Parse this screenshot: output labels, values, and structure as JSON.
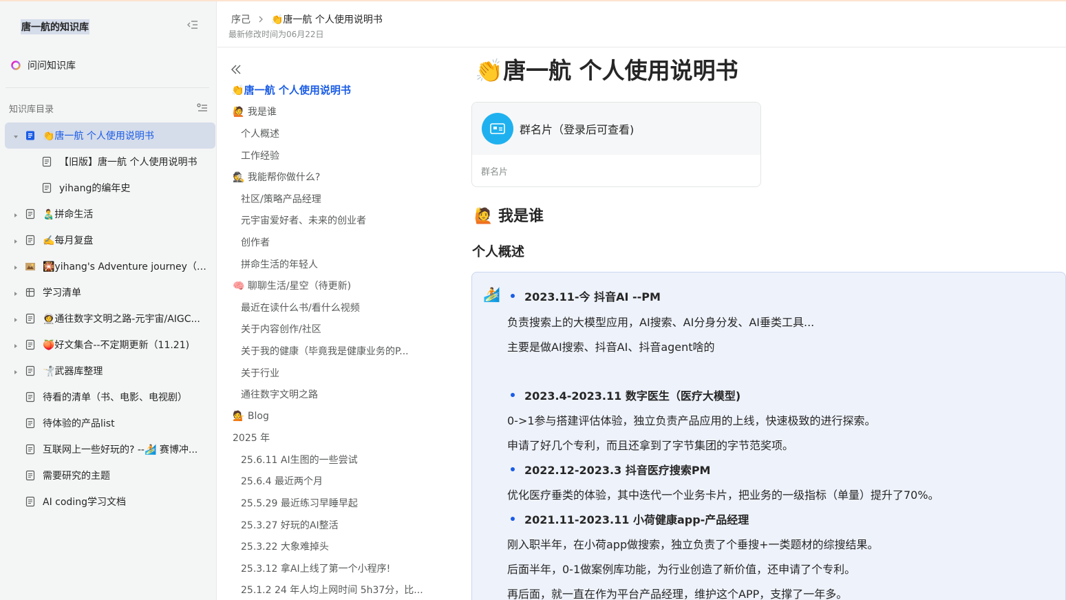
{
  "sidebar": {
    "kb_title": "唐一航的知识库",
    "ask_label": "问问知识库",
    "toc_label": "知识库目录",
    "items": [
      {
        "emoji": "👏",
        "label": "唐一航 个人使用说明书",
        "active": true
      },
      {
        "emoji": "",
        "label": "【旧版】唐一航 个人使用说明书"
      },
      {
        "emoji": "",
        "label": "yihang的编年史"
      },
      {
        "emoji": "👨‍🍼",
        "label": "拼命生活"
      },
      {
        "emoji": "✍️",
        "label": "每月复盘"
      },
      {
        "emoji": "🎇",
        "label": "yihang's Adventure journey（new..."
      },
      {
        "emoji": "",
        "label": "学习清单"
      },
      {
        "emoji": "👩‍🚀",
        "label": "通往数字文明之路-元宇宙/AIGC..."
      },
      {
        "emoji": "🍑",
        "label": "好文集合--不定期更新（11.21)"
      },
      {
        "emoji": "🤺",
        "label": "武器库整理"
      },
      {
        "emoji": "",
        "label": "待看的清单（书、电影、电视剧）"
      },
      {
        "emoji": "",
        "label": "待体验的产品list"
      },
      {
        "emoji": "",
        "label": "互联网上一些好玩的? --🏄 赛博冲..."
      },
      {
        "emoji": "",
        "label": "需要研究的主题"
      },
      {
        "emoji": "",
        "label": "AI coding学习文档"
      }
    ]
  },
  "header": {
    "crumb_root": "序己",
    "crumb_current": "👏唐一航 个人使用说明书",
    "modified": "最新修改时间为06月22日"
  },
  "outline": {
    "items": [
      "👏唐一航 个人使用说明书",
      "🙋 我是谁",
      "个人概述",
      "工作经验",
      "🕵️ 我能帮你做什么?",
      "社区/策略产品经理",
      "元宇宙爱好者、未来的创业者",
      "创作者",
      "拼命生活的年轻人",
      "🧠 聊聊生活/星空（待更新)",
      "最近在读什么书/看什么视频",
      "关于内容创作/社区",
      "关于我的健康（毕竟我是健康业务的P...",
      "关于行业",
      "通往数字文明之路",
      "💁 Blog",
      "2025 年",
      "25.6.11 AI生图的一些尝试",
      "25.6.4 最近两个月",
      "25.5.29 最近练习早睡早起",
      "25.3.27 好玩的AI整活",
      "25.3.22 大象难掉头",
      "25.3.12 拿AI上线了第一个小程序!",
      "25.1.2 24 年人均上网时间 5h37分，比..."
    ]
  },
  "doc": {
    "title": "👏唐一航 个人使用说明书",
    "card_name": "群名片（登录后可查看)",
    "card_sub": "群名片",
    "h2": "🙋 我是谁",
    "h3": "个人概述",
    "callout_emoji": "🏄",
    "lines": [
      "2023.11-今 抖音AI --PM",
      "负责搜索上的大模型应用，AI搜索、AI分身分发、AI垂类工具...",
      "主要是做AI搜索、抖音AI、抖音agent啥的",
      "2023.4-2023.11 数字医生（医疗大模型)",
      "0->1参与搭建评估体验，独立负责产品应用的上线，快速极致的进行探索。",
      "申请了好几个专利，而且还拿到了字节集团的字节范奖项。",
      "2022.12-2023.3 抖音医疗搜索PM",
      "优化医疗垂类的体验，其中迭代一个业务卡片，把业务的一级指标（单量）提升了70%。",
      "2021.11-2023.11 小荷健康app-产品经理",
      "刚入职半年，在小荷app做搜索，独立负责了个垂搜+一类题材的综搜结果。",
      "后面半年，0-1做案例库功能，为行业创造了新价值，还申请了个专利。",
      "再后面，就一直在作为平台产品经理，维护这个APP，支撑了一年多。"
    ]
  },
  "colors": {
    "accent": "#1a5ce6",
    "sidebar_bg": "#f4f5f5",
    "active_bg": "#d5dcea",
    "callout_bg": "#eef2fa"
  }
}
